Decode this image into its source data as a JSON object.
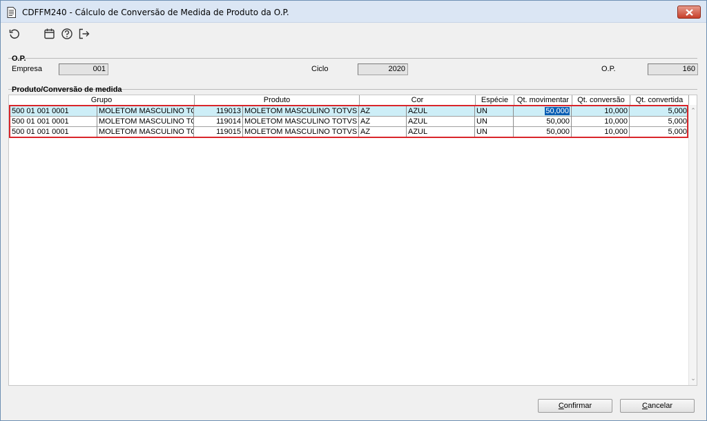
{
  "window": {
    "title": "CDFFM240 - Cálculo de Conversão de Medida de Produto da O.P."
  },
  "toolbar": {
    "icons": [
      "refresh-icon",
      "calendar-icon",
      "help-icon",
      "exit-icon"
    ]
  },
  "op_group": {
    "title": "O.P.",
    "empresa_label": "Empresa",
    "empresa_value": "001",
    "ciclo_label": "Ciclo",
    "ciclo_value": "2020",
    "op_label": "O.P.",
    "op_value": "160"
  },
  "grid_group": {
    "title": "Produto/Conversão de medida",
    "headers": {
      "grupo": "Grupo",
      "produto": "Produto",
      "cor": "Cor",
      "especie": "Espécie",
      "qt_movimentar": "Qt. movimentar",
      "qt_conversao": "Qt. conversão",
      "qt_convertida": "Qt. convertida"
    },
    "rows": [
      {
        "grupo_cod": "500 01 001 0001",
        "grupo_desc": "MOLETOM MASCULINO TOT",
        "produto_cod": "119013",
        "produto_desc": "MOLETOM MASCULINO TOTVS MO",
        "cor_cod": "AZ",
        "cor_desc": "AZUL",
        "especie": "UN",
        "qt_movimentar": "50,000",
        "qt_conversao": "10,000",
        "qt_convertida": "5,000"
      },
      {
        "grupo_cod": "500 01 001 0001",
        "grupo_desc": "MOLETOM MASCULINO TOT",
        "produto_cod": "119014",
        "produto_desc": "MOLETOM MASCULINO TOTVS MO",
        "cor_cod": "AZ",
        "cor_desc": "AZUL",
        "especie": "UN",
        "qt_movimentar": "50,000",
        "qt_conversao": "10,000",
        "qt_convertida": "5,000"
      },
      {
        "grupo_cod": "500 01 001 0001",
        "grupo_desc": "MOLETOM MASCULINO TOT",
        "produto_cod": "119015",
        "produto_desc": "MOLETOM MASCULINO TOTVS MO",
        "cor_cod": "AZ",
        "cor_desc": "AZUL",
        "especie": "UN",
        "qt_movimentar": "50,000",
        "qt_conversao": "10,000",
        "qt_convertida": "5,000"
      }
    ]
  },
  "buttons": {
    "confirmar_first": "C",
    "confirmar_rest": "onfirmar",
    "cancelar_first": "C",
    "cancelar_rest": "ancelar"
  },
  "colors": {
    "selection_row": "#cdeef7",
    "highlight_box": "#d9252a",
    "editing_cell": "#0a5fb4"
  }
}
